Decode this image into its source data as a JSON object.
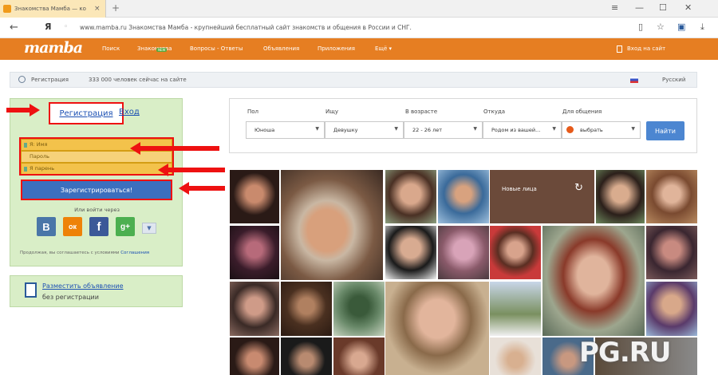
{
  "browser": {
    "tab_title": "Знакомства Мамба — ко",
    "tab_close": "×",
    "new_tab": "+",
    "back": "←",
    "home": "Я",
    "url": "www.mamba.ru   Знакомства Мамба - крупнейший бесплатный сайт знакомств и общения в России и СНГ.",
    "window_controls": [
      "≡",
      "—",
      "☐",
      "✕"
    ]
  },
  "site": {
    "logo": "mamba",
    "nav": [
      "Поиск",
      "Знакомства",
      "Вопросы - Ответы",
      "Объявления",
      "Приложения",
      "Ещё ▾"
    ],
    "nav_new_badge": "NEW",
    "signin": "Вход на сайт"
  },
  "subbar": {
    "registration": "Регистрация",
    "online_count": "333 000 человек сейчас на сайте",
    "language": "Русский"
  },
  "signup": {
    "tab_register": "Регистрация",
    "tab_login": "Вход",
    "field_name": "Я: Имя",
    "field_gender": "Пароль",
    "field_email": "Я парень",
    "register_button": "Зарегистрироваться!",
    "via_text": "Или войти через",
    "terms_prefix": "Продолжая, вы соглашаетесь с условиями ",
    "terms_link": "Соглашения"
  },
  "social": [
    {
      "name": "vk",
      "label": "B",
      "color": "#4a76a8"
    },
    {
      "name": "ok",
      "label": "ок",
      "color": "#ee8208"
    },
    {
      "name": "fb",
      "label": "f",
      "color": "#3b5998"
    },
    {
      "name": "google",
      "label": "g+",
      "color": "#4caf50"
    }
  ],
  "ad": {
    "line1": "Разместить объявление",
    "line2": "без регистрации"
  },
  "search": {
    "labels": [
      "Пол",
      "Ищу",
      "В возрасте",
      "Откуда",
      "Для общения"
    ],
    "values": [
      "Юноша",
      "Девушку",
      "22 - 26 лет",
      "Родом из вашей...",
      "выбрать"
    ],
    "find_button": "Найти"
  },
  "newfaces": {
    "label": "Новые лица",
    "refresh": "↻"
  },
  "watermark": "PG.RU"
}
